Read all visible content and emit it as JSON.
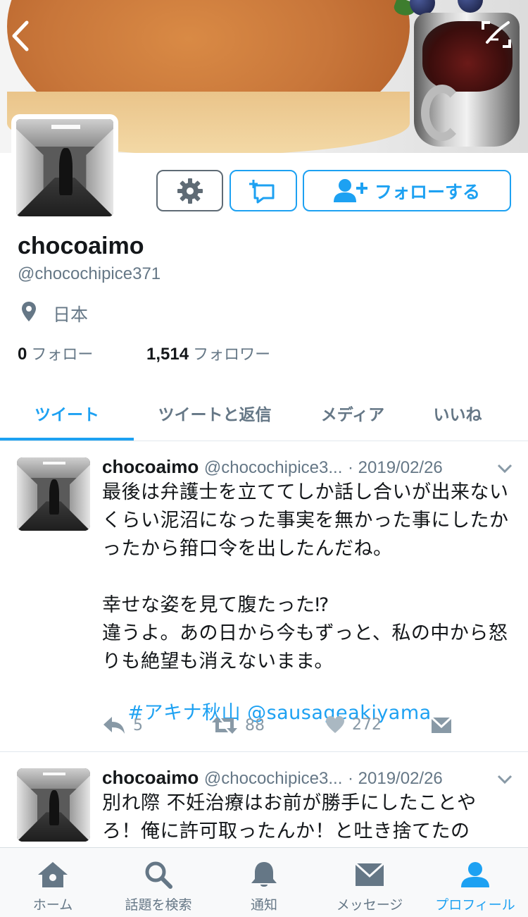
{
  "colors": {
    "accent": "#1da1f2",
    "secondary_text": "#657786",
    "icon_gray": "#8899a6"
  },
  "profile": {
    "name": "chocoaimo",
    "handle": "@chocochipice371",
    "location": "日本",
    "following_count": "0",
    "following_label": "フォロー",
    "followers_count": "1,514",
    "followers_label": "フォロワー"
  },
  "actions": {
    "follow_label": "フォローする"
  },
  "tabs": [
    {
      "label": "ツイート",
      "active": true
    },
    {
      "label": "ツイートと返信",
      "active": false
    },
    {
      "label": "メディア",
      "active": false
    },
    {
      "label": "いいね",
      "active": false
    }
  ],
  "tweets": [
    {
      "name": "chocoaimo",
      "handle": "@chocochipice3...",
      "date": "· 2019/02/26",
      "text": "最後は弁護士を立ててしか話し合いが出来ないくらい泥沼になった事実を無かった事にしたかったから箝口令を出したんだね。\n\n幸せな姿を見て腹たった⁉︎\n違うよ。あの日から今もずっと、私の中から怒りも絶望も消えないまま。",
      "hashtag": "#アキナ秋山",
      "mention": "@sausageakiyama",
      "replies": "5",
      "retweets": "88",
      "likes": "272"
    },
    {
      "name": "chocoaimo",
      "handle": "@chocochipice3...",
      "date": "· 2019/02/26",
      "text": "別れ際 不妊治療はお前が勝手にしたことやろ！俺に許可取ったんか！と吐き捨てたの"
    }
  ],
  "bottom_nav": [
    {
      "label": "ホーム",
      "icon": "home-icon",
      "active": false
    },
    {
      "label": "話題を検索",
      "icon": "search-icon",
      "active": false
    },
    {
      "label": "通知",
      "icon": "bell-icon",
      "active": false
    },
    {
      "label": "メッセージ",
      "icon": "mail-icon",
      "active": false
    },
    {
      "label": "プロフィール",
      "icon": "person-icon",
      "active": true
    }
  ]
}
